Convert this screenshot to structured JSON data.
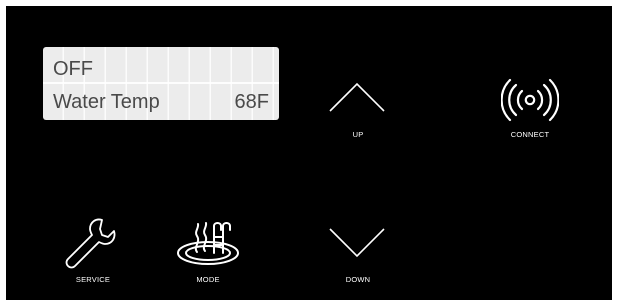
{
  "display": {
    "line1": "OFF",
    "line2_label": "Water Temp",
    "line2_value": "68F"
  },
  "buttons": {
    "up": {
      "label": "UP",
      "icon": "chevron-up-icon"
    },
    "connect": {
      "label": "CONNECT",
      "icon": "wireless-signal-icon"
    },
    "service": {
      "label": "SERVICE",
      "icon": "wrench-icon"
    },
    "mode": {
      "label": "MODE",
      "icon": "hot-tub-icon"
    },
    "down": {
      "label": "DOWN",
      "icon": "chevron-down-icon"
    }
  },
  "colors": {
    "panel": "#000000",
    "lcd_background": "#ececec",
    "lcd_text": "#4a4a4a",
    "icon": "#ffffff"
  }
}
